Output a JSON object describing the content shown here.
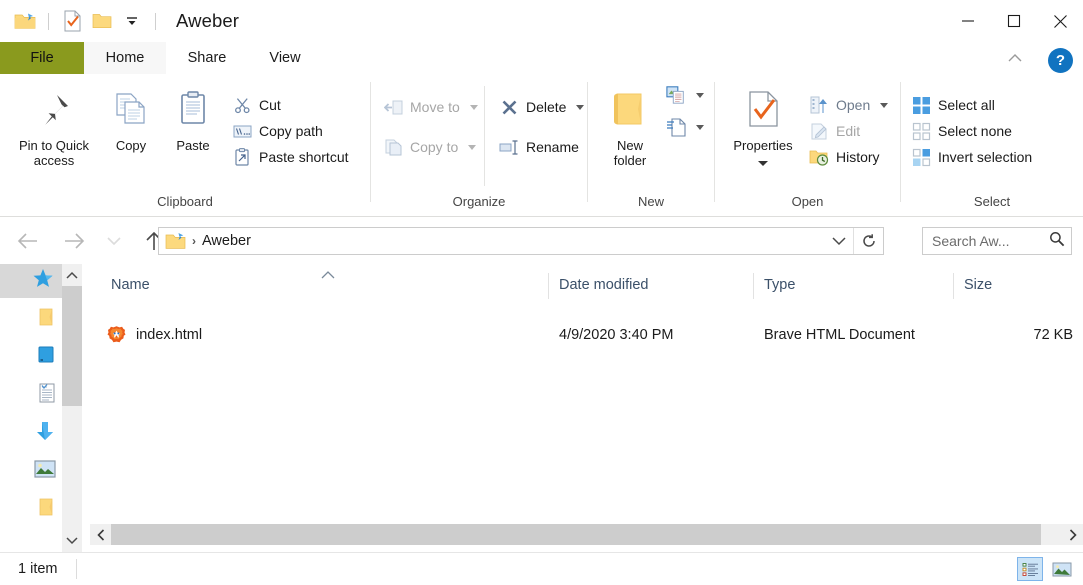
{
  "window": {
    "title": "Aweber",
    "quick_access_icons": [
      "pinned-folder-icon",
      "checkmark-document-icon",
      "folder-icon",
      "customize-dropdown-icon"
    ],
    "controls": {
      "minimize": "minimize-button",
      "maximize": "maximize-button",
      "close": "close-button"
    }
  },
  "tabs": [
    {
      "id": "file",
      "label": "File",
      "active": false,
      "accent": "#8a9a1e"
    },
    {
      "id": "home",
      "label": "Home",
      "active": true
    },
    {
      "id": "share",
      "label": "Share",
      "active": false
    },
    {
      "id": "view",
      "label": "View",
      "active": false
    }
  ],
  "ribbon": {
    "collapse_label": "^",
    "help_label": "?",
    "groups": [
      {
        "id": "clipboard",
        "label": "Clipboard",
        "big_buttons": [
          {
            "id": "pin-to-quick-access",
            "label": "Pin to Quick\naccess",
            "line1": "Pin to Quick",
            "line2": "access",
            "icon": "pin-icon"
          },
          {
            "id": "copy",
            "label": "Copy",
            "icon": "copy-icon"
          },
          {
            "id": "paste",
            "label": "Paste",
            "icon": "paste-icon"
          }
        ],
        "small_buttons": [
          {
            "id": "cut",
            "label": "Cut",
            "icon": "scissors-icon",
            "disabled": false
          },
          {
            "id": "copy-path",
            "label": "Copy path",
            "icon": "copy-path-icon",
            "disabled": false
          },
          {
            "id": "paste-shortcut",
            "label": "Paste shortcut",
            "icon": "paste-shortcut-icon",
            "disabled": false
          }
        ]
      },
      {
        "id": "organize",
        "label": "Organize",
        "small_buttons": [
          {
            "id": "move-to",
            "label": "Move to",
            "icon": "move-to-icon",
            "disabled": true,
            "caret": true
          },
          {
            "id": "copy-to",
            "label": "Copy to",
            "icon": "copy-to-icon",
            "disabled": true,
            "caret": true
          },
          {
            "id": "delete",
            "label": "Delete",
            "icon": "delete-x-icon",
            "disabled": false,
            "caret": true
          },
          {
            "id": "rename",
            "label": "Rename",
            "icon": "rename-icon",
            "disabled": false,
            "caret": false
          }
        ]
      },
      {
        "id": "new",
        "label": "New",
        "big_buttons": [
          {
            "id": "new-folder",
            "label": "New folder",
            "line1": "New",
            "line2": "folder",
            "icon": "new-folder-icon"
          }
        ],
        "small_buttons": [
          {
            "id": "new-item",
            "label": "",
            "icon": "new-item-icon",
            "caret": true
          },
          {
            "id": "easy-access",
            "label": "",
            "icon": "easy-access-icon",
            "caret": true
          }
        ]
      },
      {
        "id": "open",
        "label": "Open",
        "big_buttons": [
          {
            "id": "properties",
            "label": "Properties",
            "icon": "properties-checkmark-icon",
            "caret": true
          }
        ],
        "small_buttons": [
          {
            "id": "open",
            "label": "Open",
            "icon": "open-icon",
            "disabled": false,
            "caret": true
          },
          {
            "id": "edit",
            "label": "Edit",
            "icon": "edit-pencil-icon",
            "disabled": true,
            "caret": false
          },
          {
            "id": "history",
            "label": "History",
            "icon": "history-icon",
            "disabled": false,
            "caret": false
          }
        ]
      },
      {
        "id": "select",
        "label": "Select",
        "small_buttons": [
          {
            "id": "select-all",
            "label": "Select all",
            "icon": "select-all-icon"
          },
          {
            "id": "select-none",
            "label": "Select none",
            "icon": "select-none-icon"
          },
          {
            "id": "invert-selection",
            "label": "Invert selection",
            "icon": "invert-selection-icon"
          }
        ]
      }
    ]
  },
  "navigation": {
    "back": "back-arrow",
    "forward": "forward-arrow",
    "recent": "recent-locations-dropdown",
    "up": "up-arrow",
    "breadcrumb": {
      "folder_icon": "pinned-folder-icon",
      "separator": "›",
      "path": "Aweber"
    },
    "address_dropdown": "⌄",
    "refresh": "↻"
  },
  "search": {
    "placeholder": "Search Aw...",
    "value": "",
    "icon": "magnifier-icon"
  },
  "sidebar": {
    "items": [
      {
        "id": "quick-access",
        "icon": "blue-star-icon",
        "selected": true
      },
      {
        "id": "folder-1",
        "icon": "folder-icon",
        "selected": false
      },
      {
        "id": "desktop",
        "icon": "desktop-icon",
        "selected": false
      },
      {
        "id": "documents",
        "icon": "document-icon",
        "selected": false
      },
      {
        "id": "downloads",
        "icon": "download-arrow-icon",
        "selected": false
      },
      {
        "id": "pictures",
        "icon": "picture-icon",
        "selected": false
      },
      {
        "id": "folder-2",
        "icon": "folder-icon",
        "selected": false
      }
    ]
  },
  "file_list": {
    "columns": [
      {
        "id": "name",
        "label": "Name",
        "sorted": "asc"
      },
      {
        "id": "date_modified",
        "label": "Date modified"
      },
      {
        "id": "type",
        "label": "Type"
      },
      {
        "id": "size",
        "label": "Size"
      }
    ],
    "rows": [
      {
        "name": "index.html",
        "date_modified": "4/9/2020 3:40 PM",
        "type": "Brave HTML Document",
        "size": "72 KB",
        "icon": "brave-lion-icon"
      }
    ]
  },
  "status_bar": {
    "item_count": "1 item",
    "view_buttons": [
      {
        "id": "details-view",
        "icon": "details-view-icon",
        "selected": true
      },
      {
        "id": "large-icons-view",
        "icon": "large-icons-view-icon",
        "selected": false
      }
    ]
  }
}
